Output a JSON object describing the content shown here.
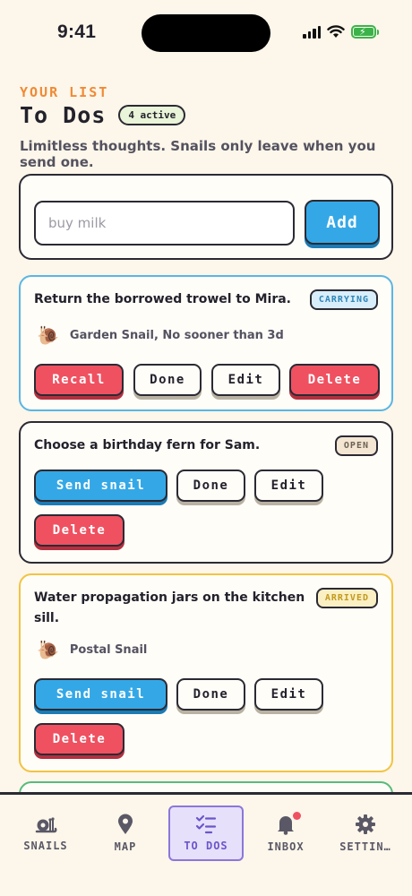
{
  "status_bar": {
    "time": "9:41"
  },
  "header": {
    "eyebrow": "YOUR LIST",
    "title": "To Dos",
    "count_badge": "4 active",
    "subtitle": "Limitless thoughts. Snails only leave when you send one."
  },
  "add_form": {
    "placeholder": "buy milk",
    "value": "",
    "button_label": "Add"
  },
  "todos": [
    {
      "text": "Return the borrowed trowel to Mira.",
      "status": "CARRYING",
      "snail": "Garden Snail, No sooner than 3d",
      "actions": [
        "Recall",
        "Done",
        "Edit",
        "Delete"
      ]
    },
    {
      "text": "Choose a birthday fern for Sam.",
      "status": "OPEN",
      "actions": [
        "Send snail",
        "Done",
        "Edit",
        "Delete"
      ]
    },
    {
      "text_line1": "Water propagation jars on the kitchen",
      "text_line2": "sill.",
      "status": "ARRIVED",
      "snail": "Postal Snail",
      "actions": [
        "Send snail",
        "Done",
        "Edit",
        "Delete"
      ]
    }
  ],
  "tabs": [
    {
      "label": "SNAILS",
      "icon": "snail-icon"
    },
    {
      "label": "MAP",
      "icon": "map-pin-icon"
    },
    {
      "label": "TO DOS",
      "icon": "checklist-icon",
      "active": true
    },
    {
      "label": "INBOX",
      "icon": "bell-icon",
      "badge": true
    },
    {
      "label": "SETTIN…",
      "icon": "gear-icon"
    }
  ],
  "colors": {
    "background": "#fdf6ea",
    "accent_orange": "#f08a35",
    "blue": "#34a8e6",
    "red": "#ef5161",
    "purple": "#8b77d9",
    "yellow": "#f1c442",
    "green": "#58bb7a"
  }
}
